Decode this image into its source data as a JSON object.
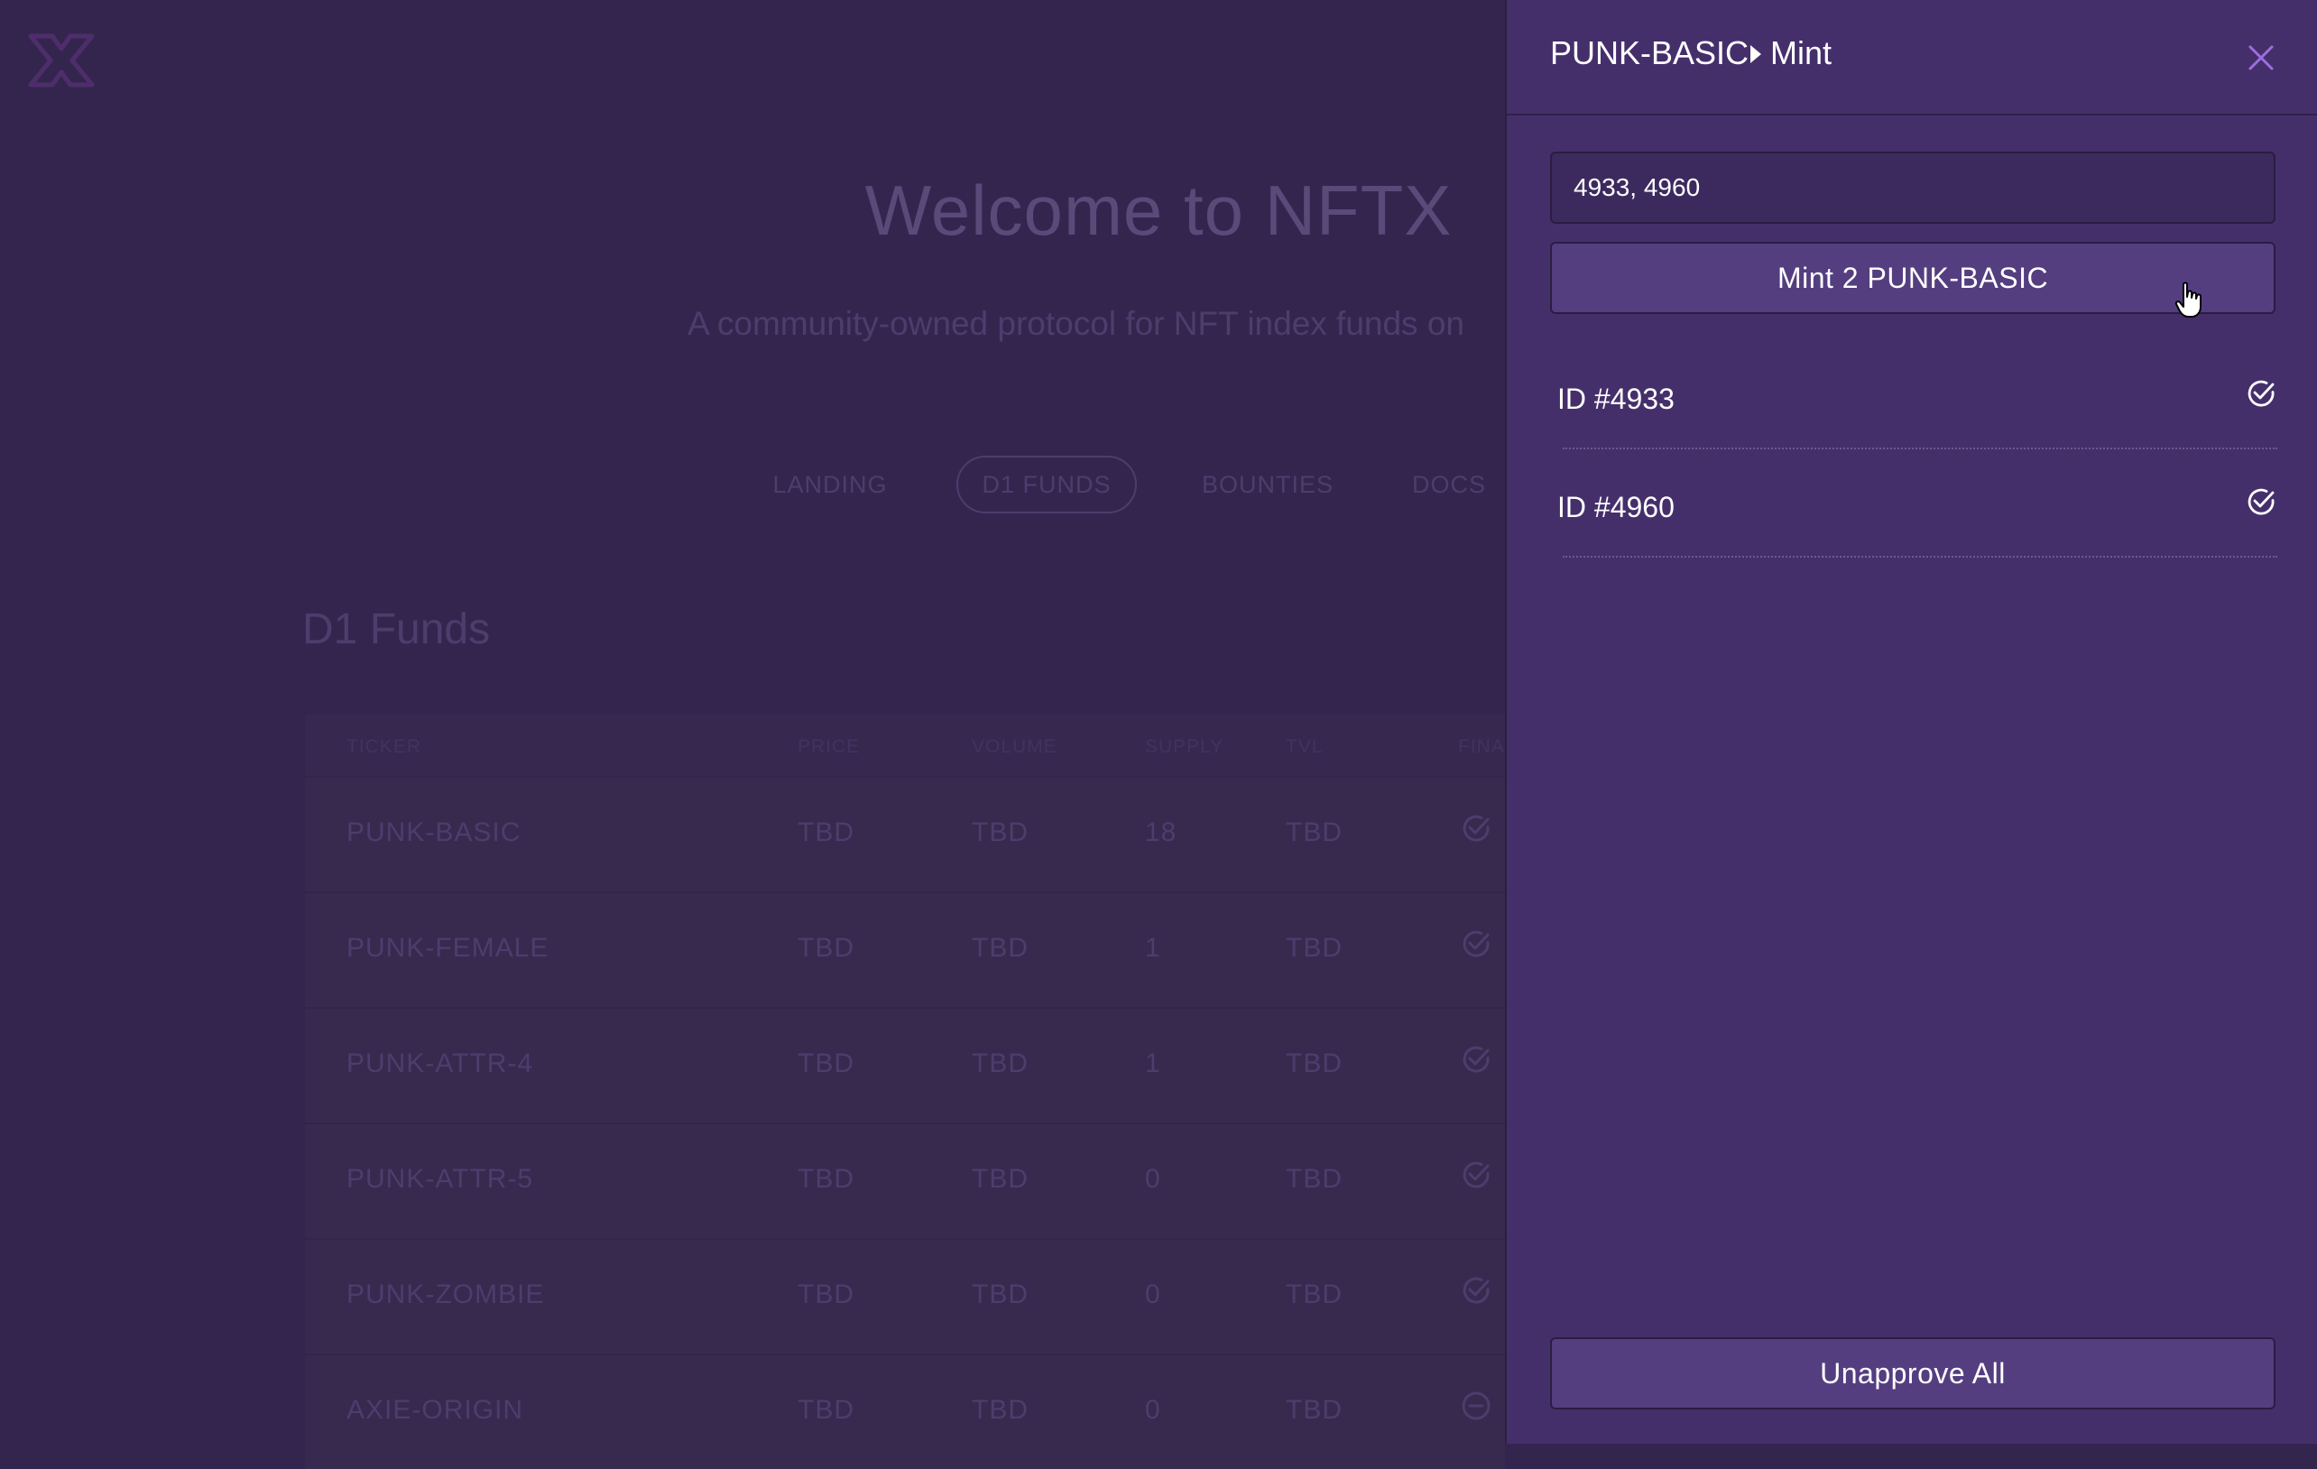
{
  "background": {
    "hero_title": "Welcome to NFTX",
    "hero_subtitle": "A community-owned protocol for NFT index funds on",
    "nav": [
      {
        "label": "LANDING"
      },
      {
        "label": "D1 FUNDS"
      },
      {
        "label": "BOUNTIES"
      },
      {
        "label": "DOCS"
      }
    ],
    "section_title": "D1 Funds",
    "table": {
      "headers": [
        "TICKER",
        "PRICE",
        "VOLUME",
        "SUPPLY",
        "TVL",
        "FINA"
      ],
      "rows": [
        {
          "ticker": "PUNK-BASIC",
          "price": "TBD",
          "volume": "TBD",
          "supply": "18",
          "tvl": "TBD",
          "status": "check-circle-icon"
        },
        {
          "ticker": "PUNK-FEMALE",
          "price": "TBD",
          "volume": "TBD",
          "supply": "1",
          "tvl": "TBD",
          "status": "check-circle-icon"
        },
        {
          "ticker": "PUNK-ATTR-4",
          "price": "TBD",
          "volume": "TBD",
          "supply": "1",
          "tvl": "TBD",
          "status": "check-circle-icon"
        },
        {
          "ticker": "PUNK-ATTR-5",
          "price": "TBD",
          "volume": "TBD",
          "supply": "0",
          "tvl": "TBD",
          "status": "check-circle-icon"
        },
        {
          "ticker": "PUNK-ZOMBIE",
          "price": "TBD",
          "volume": "TBD",
          "supply": "0",
          "tvl": "TBD",
          "status": "check-circle-icon"
        },
        {
          "ticker": "AXIE-ORIGIN",
          "price": "TBD",
          "volume": "TBD",
          "supply": "0",
          "tvl": "TBD",
          "status": "minus-circle-icon"
        }
      ]
    }
  },
  "panel": {
    "breadcrumb": {
      "fund": "PUNK-BASIC",
      "action": "Mint"
    },
    "ids_input_value": "4933, 4960",
    "mint_button_label": "Mint 2 PUNK-BASIC",
    "items": [
      {
        "label": "ID #4933",
        "status_icon": "check-circle-icon"
      },
      {
        "label": "ID #4960",
        "status_icon": "check-circle-icon"
      }
    ],
    "unapprove_button_label": "Unapprove All"
  },
  "colors": {
    "background": "#34254f",
    "panel": "#452f6b",
    "button": "#543e80",
    "accent": "#9b6fe0"
  }
}
